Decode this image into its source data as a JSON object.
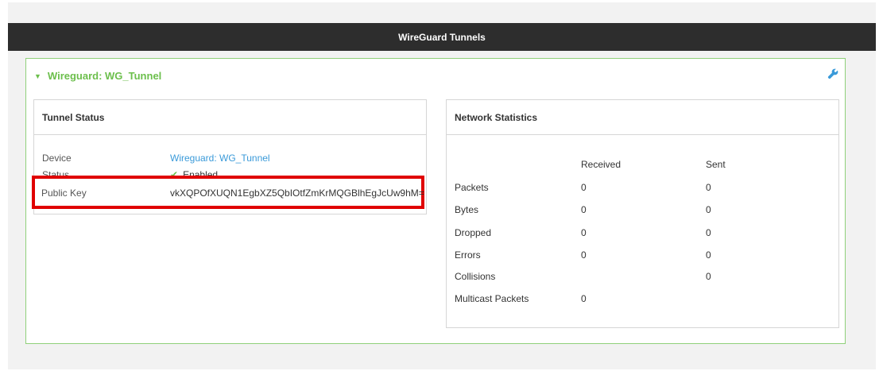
{
  "title": "WireGuard Tunnels",
  "panel": {
    "header": "Wireguard: WG_Tunnel",
    "edit_icon": "wrench-icon",
    "accent_color": "#6cbf4c",
    "border_color": "#8fd07a"
  },
  "tunnel_status": {
    "title": "Tunnel Status",
    "rows": [
      {
        "label": "Device",
        "value": "Wireguard: WG_Tunnel"
      },
      {
        "label": "Status",
        "value": "Enabled"
      },
      {
        "label": "Public Key",
        "value": "vkXQPOfXUQN1EgbXZ5QbIOtfZmKrMQGBlhEgJcUw9hM="
      }
    ]
  },
  "network_statistics": {
    "title": "Network Statistics",
    "columns": [
      "Received",
      "Sent"
    ],
    "rows": [
      {
        "label": "Packets",
        "received": "0",
        "sent": "0"
      },
      {
        "label": "Bytes",
        "received": "0",
        "sent": "0"
      },
      {
        "label": "Dropped",
        "received": "0",
        "sent": "0"
      },
      {
        "label": "Errors",
        "received": "0",
        "sent": "0"
      },
      {
        "label": "Collisions",
        "received": "",
        "sent": "0"
      },
      {
        "label": "Multicast Packets",
        "received": "0",
        "sent": ""
      }
    ]
  },
  "highlight_color": "#e00000"
}
